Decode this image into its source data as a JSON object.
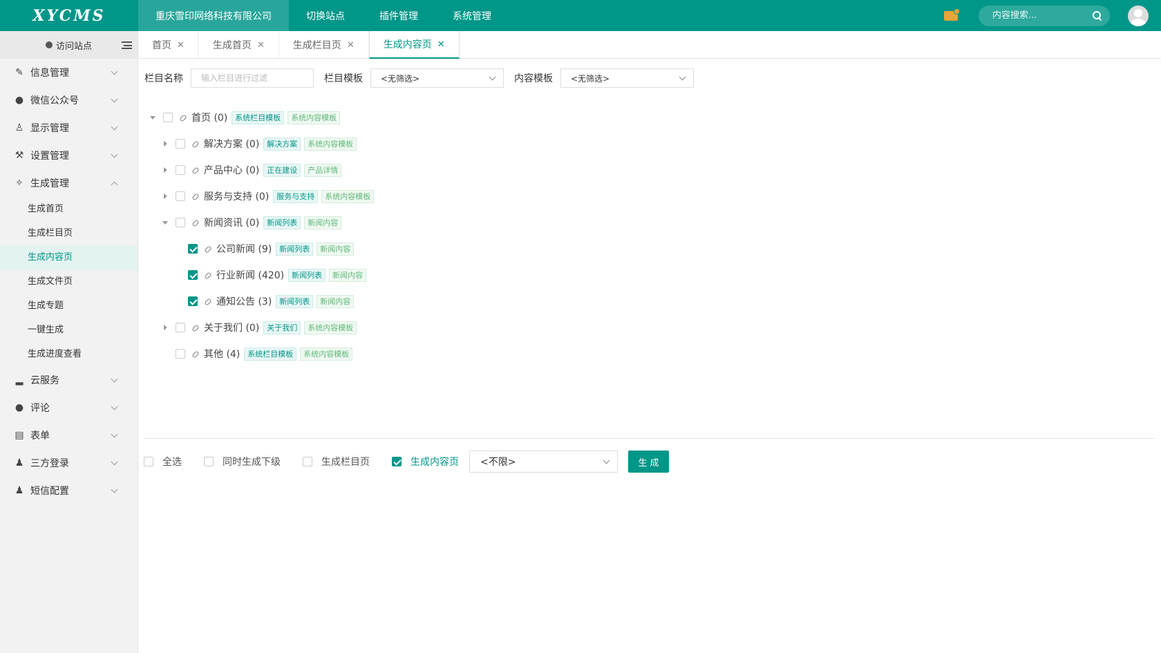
{
  "header": {
    "logo": "XYCMS",
    "nav": [
      "重庆雪印网络科技有限公司",
      "切换站点",
      "插件管理",
      "系统管理"
    ],
    "search_placeholder": "内容搜索..."
  },
  "sidebar": {
    "visit_site": "访问站点",
    "groups": [
      {
        "label": "信息管理",
        "icon": "edit-icon"
      },
      {
        "label": "微信公众号",
        "icon": "wechat-icon"
      },
      {
        "label": "显示管理",
        "icon": "shirt-icon"
      },
      {
        "label": "设置管理",
        "icon": "wrench-icon"
      },
      {
        "label": "生成管理",
        "icon": "magic-wand-icon"
      },
      {
        "label": "云服务",
        "icon": "bar-chart-icon"
      },
      {
        "label": "评论",
        "icon": "comment-icon"
      },
      {
        "label": "表单",
        "icon": "form-icon"
      },
      {
        "label": "三方登录",
        "icon": "user-icon"
      },
      {
        "label": "短信配置",
        "icon": "user-icon"
      }
    ],
    "generate_sub": [
      "生成首页",
      "生成栏目页",
      "生成内容页",
      "生成文件页",
      "生成专题",
      "一键生成",
      "生成进度查看"
    ]
  },
  "tabs": [
    "首页",
    "生成首页",
    "生成栏目页",
    "生成内容页"
  ],
  "filter": {
    "column_name_label": "栏目名称",
    "column_name_placeholder": "输入栏目进行过滤",
    "column_template_label": "栏目模板",
    "column_template_value": "<无筛选>",
    "content_template_label": "内容模板",
    "content_template_value": "<无筛选>"
  },
  "tree": [
    {
      "label": "首页 (0)",
      "tags": [
        "系统栏目模板",
        "系统内容模板"
      ],
      "checked": false
    },
    {
      "label": "解决方案 (0)",
      "tags": [
        "解决方案",
        "系统内容模板"
      ],
      "checked": false
    },
    {
      "label": "产品中心 (0)",
      "tags": [
        "正在建设",
        "产品详情"
      ],
      "checked": false
    },
    {
      "label": "服务与支持 (0)",
      "tags": [
        "服务与支持",
        "系统内容模板"
      ],
      "checked": false
    },
    {
      "label": "新闻资讯 (0)",
      "tags": [
        "新闻列表",
        "新闻内容"
      ],
      "checked": false
    },
    {
      "label": "公司新闻 (9)",
      "tags": [
        "新闻列表",
        "新闻内容"
      ],
      "checked": true
    },
    {
      "label": "行业新闻 (420)",
      "tags": [
        "新闻列表",
        "新闻内容"
      ],
      "checked": true
    },
    {
      "label": "通知公告 (3)",
      "tags": [
        "新闻列表",
        "新闻内容"
      ],
      "checked": true
    },
    {
      "label": "关于我们 (0)",
      "tags": [
        "关于我们",
        "系统内容模板"
      ],
      "checked": false
    },
    {
      "label": "其他 (4)",
      "tags": [
        "系统栏目模板",
        "系统内容模板"
      ],
      "checked": false
    }
  ],
  "bottom": {
    "select_all": "全选",
    "gen_sub": "同时生成下级",
    "gen_column": "生成栏目页",
    "gen_content": "生成内容页",
    "limit_value": "<不限>",
    "generate_button": "生成"
  }
}
